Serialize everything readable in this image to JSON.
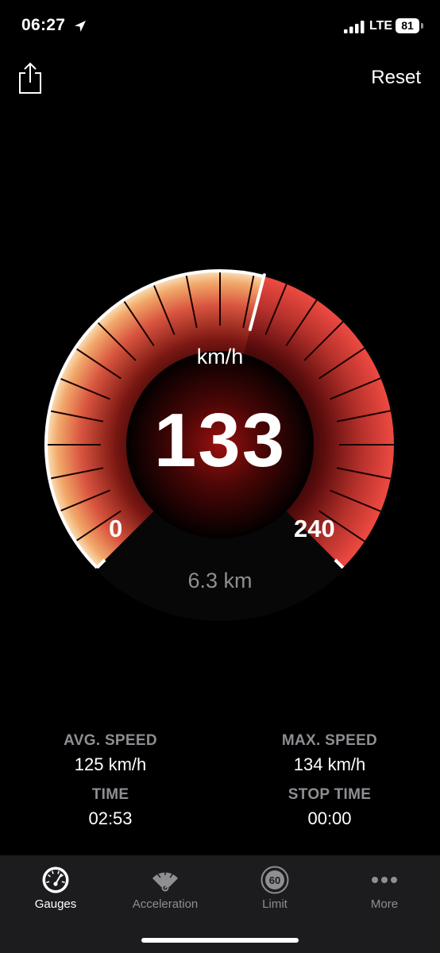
{
  "status_bar": {
    "time": "06:27",
    "network": "LTE",
    "battery": "81",
    "icons": [
      "location-arrow-icon",
      "cellular-signal-icon",
      "battery-icon"
    ]
  },
  "header": {
    "share_icon": "share-icon",
    "reset_label": "Reset"
  },
  "gauge": {
    "unit": "km/h",
    "speed": "133",
    "min_label": "0",
    "max_label": "240",
    "min_value": 0,
    "max_value": 240,
    "current_value": 133,
    "distance": "6.3 km",
    "colors": {
      "accent": "#e8453c",
      "needle": "#ffffff",
      "glow": "#ff3b30"
    }
  },
  "stats": {
    "avg_speed": {
      "label": "AVG. SPEED",
      "value": "125 km/h"
    },
    "max_speed": {
      "label": "MAX. SPEED",
      "value": "134 km/h"
    },
    "time": {
      "label": "TIME",
      "value": "02:53"
    },
    "stop_time": {
      "label": "STOP TIME",
      "value": "00:00"
    }
  },
  "tabs": [
    {
      "label": "Gauges",
      "icon": "speedometer-icon",
      "active": true
    },
    {
      "label": "Acceleration",
      "icon": "acceleration-gauge-icon",
      "active": false
    },
    {
      "label": "Limit",
      "icon": "speed-limit-sign-icon",
      "icon_text": "60",
      "active": false
    },
    {
      "label": "More",
      "icon": "more-dots-icon",
      "active": false
    }
  ]
}
